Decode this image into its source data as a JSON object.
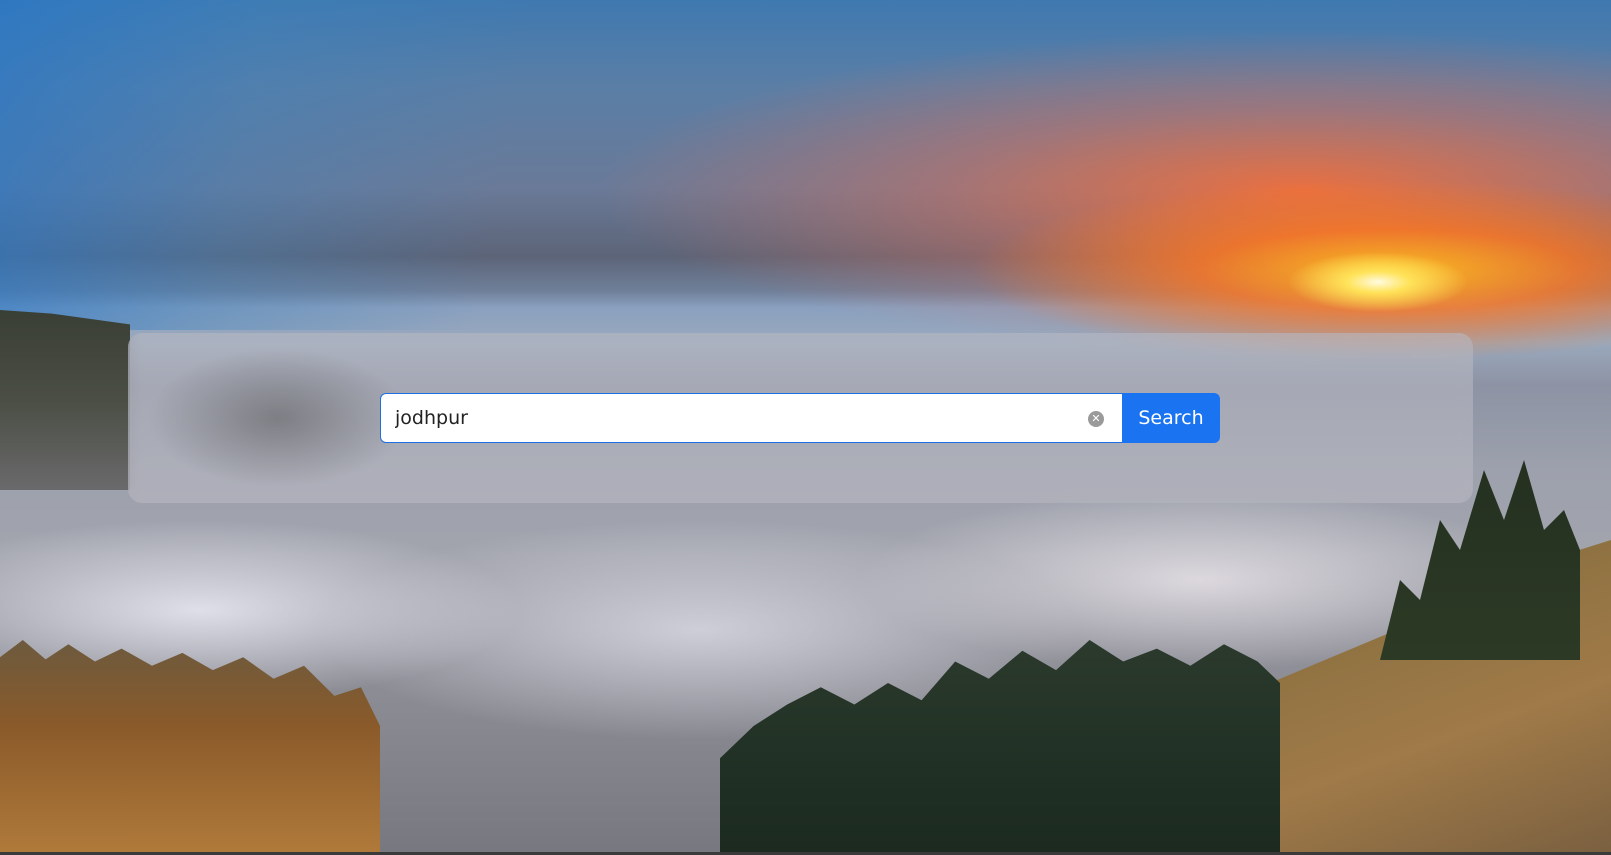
{
  "search": {
    "value": "jodhpur",
    "button_label": "Search",
    "clear_icon": "clear-icon"
  },
  "colors": {
    "accent": "#1a73f0",
    "input_border": "#1f6fe0"
  },
  "background": {
    "type": "scenic-sunset-photo"
  }
}
